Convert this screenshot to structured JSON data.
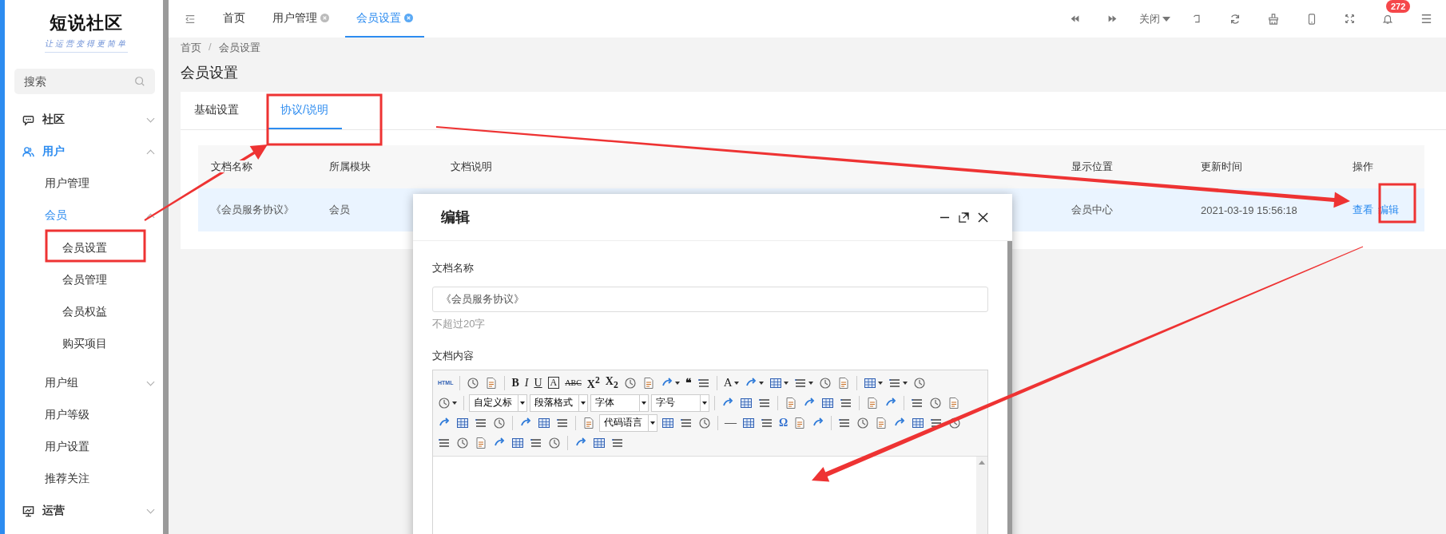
{
  "sidebar": {
    "logo": "短说社区",
    "slogan": "让运营变得更简单",
    "search": {
      "placeholder": "搜索"
    },
    "menu": [
      {
        "label": "社区",
        "expanded": false,
        "selected": false
      },
      {
        "label": "用户",
        "expanded": true,
        "selected": true,
        "children": [
          {
            "label": "用户管理",
            "selected": false
          },
          {
            "label": "会员",
            "expanded": true,
            "selected": true,
            "children": [
              {
                "label": "会员设置",
                "selected": false
              },
              {
                "label": "会员管理",
                "selected": false
              },
              {
                "label": "会员权益",
                "selected": false
              },
              {
                "label": "购买项目",
                "selected": false
              }
            ]
          },
          {
            "label": "用户组",
            "expanded": false,
            "selected": false
          },
          {
            "label": "用户等级",
            "selected": false
          },
          {
            "label": "用户设置",
            "selected": false
          },
          {
            "label": "推荐关注",
            "selected": false
          }
        ]
      },
      {
        "label": "运营",
        "expanded": false,
        "selected": false
      }
    ]
  },
  "topbar": {
    "tabs": [
      {
        "label": "首页",
        "selected": false,
        "closable": false
      },
      {
        "label": "用户管理",
        "selected": false,
        "closable": true
      },
      {
        "label": "会员设置",
        "selected": true,
        "closable": true
      }
    ],
    "close_menu": "关闭",
    "notification_count": "272"
  },
  "breadcrumb": [
    {
      "kind": "link",
      "text": "首页"
    },
    {
      "kind": "separator",
      "text": "/"
    },
    {
      "kind": "link",
      "text": "会员设置"
    }
  ],
  "page_title": "会员设置",
  "card_tabs": [
    {
      "label": "基础设置",
      "selected": false
    },
    {
      "label": "协议/说明",
      "selected": true
    }
  ],
  "table": {
    "columns": [
      "文档名称",
      "所属模块",
      "文档说明",
      "显示位置",
      "更新时间",
      "操作"
    ],
    "rows": [
      {
        "name": "《会员服务协议》",
        "module": "会员",
        "location": "会员中心",
        "updated": "2021-03-19 15:56:18",
        "actions": [
          "查看",
          "编辑"
        ],
        "selected": true
      }
    ]
  },
  "modal": {
    "title": "编辑",
    "name_label": "文档名称",
    "name_value": "《会员服务协议》",
    "name_hint": "不超过20字",
    "content_label": "文档内容",
    "toolbar_rows": [
      [
        {
          "kind": "tiny",
          "text": "HTML"
        },
        {
          "kind": "sep"
        },
        {
          "kind": "icon"
        },
        {
          "kind": "icon"
        },
        {
          "kind": "sep"
        },
        {
          "kind": "bold",
          "text": "B"
        },
        {
          "kind": "italic",
          "text": "I"
        },
        {
          "kind": "underline",
          "text": "U"
        },
        {
          "kind": "boxed",
          "text": "A"
        },
        {
          "kind": "strike",
          "text": "ABC"
        },
        {
          "kind": "bold",
          "text": "X$^{2}$"
        },
        {
          "kind": "bold",
          "text": "X$_{2}$"
        },
        {
          "kind": "icon"
        },
        {
          "kind": "icon"
        },
        {
          "kind": "icon",
          "dropdown": true
        },
        {
          "kind": "bold",
          "text": "❝"
        },
        {
          "kind": "icon"
        },
        {
          "kind": "sep"
        },
        {
          "kind": "plain",
          "text": "A",
          "dropdown": true
        },
        {
          "kind": "icon",
          "dropdown": true
        },
        {
          "kind": "icon",
          "dropdown": true
        },
        {
          "kind": "icon",
          "dropdown": true
        },
        {
          "kind": "icon"
        },
        {
          "kind": "icon"
        },
        {
          "kind": "sep"
        },
        {
          "kind": "icon",
          "dropdown": true
        },
        {
          "kind": "icon",
          "dropdown": true
        },
        {
          "kind": "icon"
        }
      ],
      [
        {
          "kind": "icon",
          "dropdown": true
        },
        {
          "kind": "sep"
        },
        {
          "kind": "select",
          "text": "自定义标"
        },
        {
          "kind": "select",
          "text": "段落格式"
        },
        {
          "kind": "select",
          "text": "字体"
        },
        {
          "kind": "select",
          "text": "字号"
        },
        {
          "kind": "sep"
        },
        {
          "kind": "icon"
        },
        {
          "kind": "icon"
        },
        {
          "kind": "icon"
        },
        {
          "kind": "sep"
        },
        {
          "kind": "icon"
        },
        {
          "kind": "icon"
        },
        {
          "kind": "icon"
        },
        {
          "kind": "icon"
        },
        {
          "kind": "sep"
        },
        {
          "kind": "icon"
        },
        {
          "kind": "icon"
        },
        {
          "kind": "sep"
        },
        {
          "kind": "icon"
        },
        {
          "kind": "icon"
        },
        {
          "kind": "icon"
        }
      ],
      [
        {
          "kind": "icon"
        },
        {
          "kind": "icon"
        },
        {
          "kind": "icon"
        },
        {
          "kind": "icon"
        },
        {
          "kind": "sep"
        },
        {
          "kind": "icon"
        },
        {
          "kind": "icon"
        },
        {
          "kind": "icon"
        },
        {
          "kind": "sep"
        },
        {
          "kind": "icon"
        },
        {
          "kind": "select",
          "text": "代码语言"
        },
        {
          "kind": "icon"
        },
        {
          "kind": "icon"
        },
        {
          "kind": "icon"
        },
        {
          "kind": "sep"
        },
        {
          "kind": "plain",
          "text": "—"
        },
        {
          "kind": "icon"
        },
        {
          "kind": "icon"
        },
        {
          "kind": "symbol",
          "text": "Ω"
        },
        {
          "kind": "icon"
        },
        {
          "kind": "icon"
        },
        {
          "kind": "sep"
        },
        {
          "kind": "icon"
        },
        {
          "kind": "icon"
        },
        {
          "kind": "icon"
        },
        {
          "kind": "icon"
        },
        {
          "kind": "icon"
        },
        {
          "kind": "icon"
        },
        {
          "kind": "icon"
        }
      ],
      [
        {
          "kind": "icon"
        },
        {
          "kind": "icon"
        },
        {
          "kind": "icon"
        },
        {
          "kind": "icon"
        },
        {
          "kind": "icon"
        },
        {
          "kind": "icon"
        },
        {
          "kind": "icon"
        },
        {
          "kind": "sep"
        },
        {
          "kind": "icon"
        },
        {
          "kind": "icon"
        },
        {
          "kind": "icon"
        }
      ]
    ]
  }
}
